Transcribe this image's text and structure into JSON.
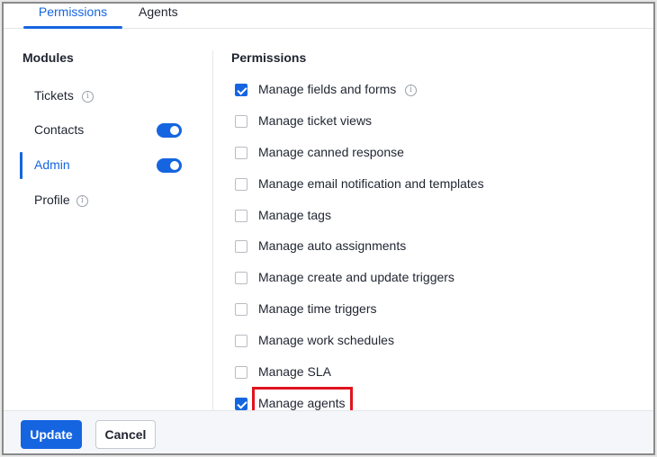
{
  "tabs": [
    {
      "label": "Permissions",
      "active": true
    },
    {
      "label": "Agents",
      "active": false
    }
  ],
  "modules": {
    "title": "Modules",
    "items": [
      {
        "label": "Tickets",
        "info": true,
        "toggle": null,
        "active": false
      },
      {
        "label": "Contacts",
        "info": false,
        "toggle": "on",
        "active": false
      },
      {
        "label": "Admin",
        "info": false,
        "toggle": "on",
        "active": true
      },
      {
        "label": "Profile",
        "info": true,
        "toggle": null,
        "active": false
      }
    ]
  },
  "permissions": {
    "title": "Permissions",
    "items": [
      {
        "label": "Manage fields and forms",
        "checked": true,
        "info": true
      },
      {
        "label": "Manage ticket views",
        "checked": false
      },
      {
        "label": "Manage canned response",
        "checked": false
      },
      {
        "label": "Manage email notification and templates",
        "checked": false
      },
      {
        "label": "Manage tags",
        "checked": false
      },
      {
        "label": "Manage auto assignments",
        "checked": false
      },
      {
        "label": "Manage create and update triggers",
        "checked": false
      },
      {
        "label": "Manage time triggers",
        "checked": false
      },
      {
        "label": "Manage work schedules",
        "checked": false
      },
      {
        "label": "Manage SLA",
        "checked": false
      },
      {
        "label": "Manage agents",
        "checked": true,
        "highlighted": true
      }
    ]
  },
  "footer": {
    "update_label": "Update",
    "cancel_label": "Cancel"
  },
  "colors": {
    "accent": "#1565e0",
    "highlight": "#e0141e"
  },
  "icons": {
    "info": "info-circle-icon",
    "check": "checkmark-icon"
  }
}
